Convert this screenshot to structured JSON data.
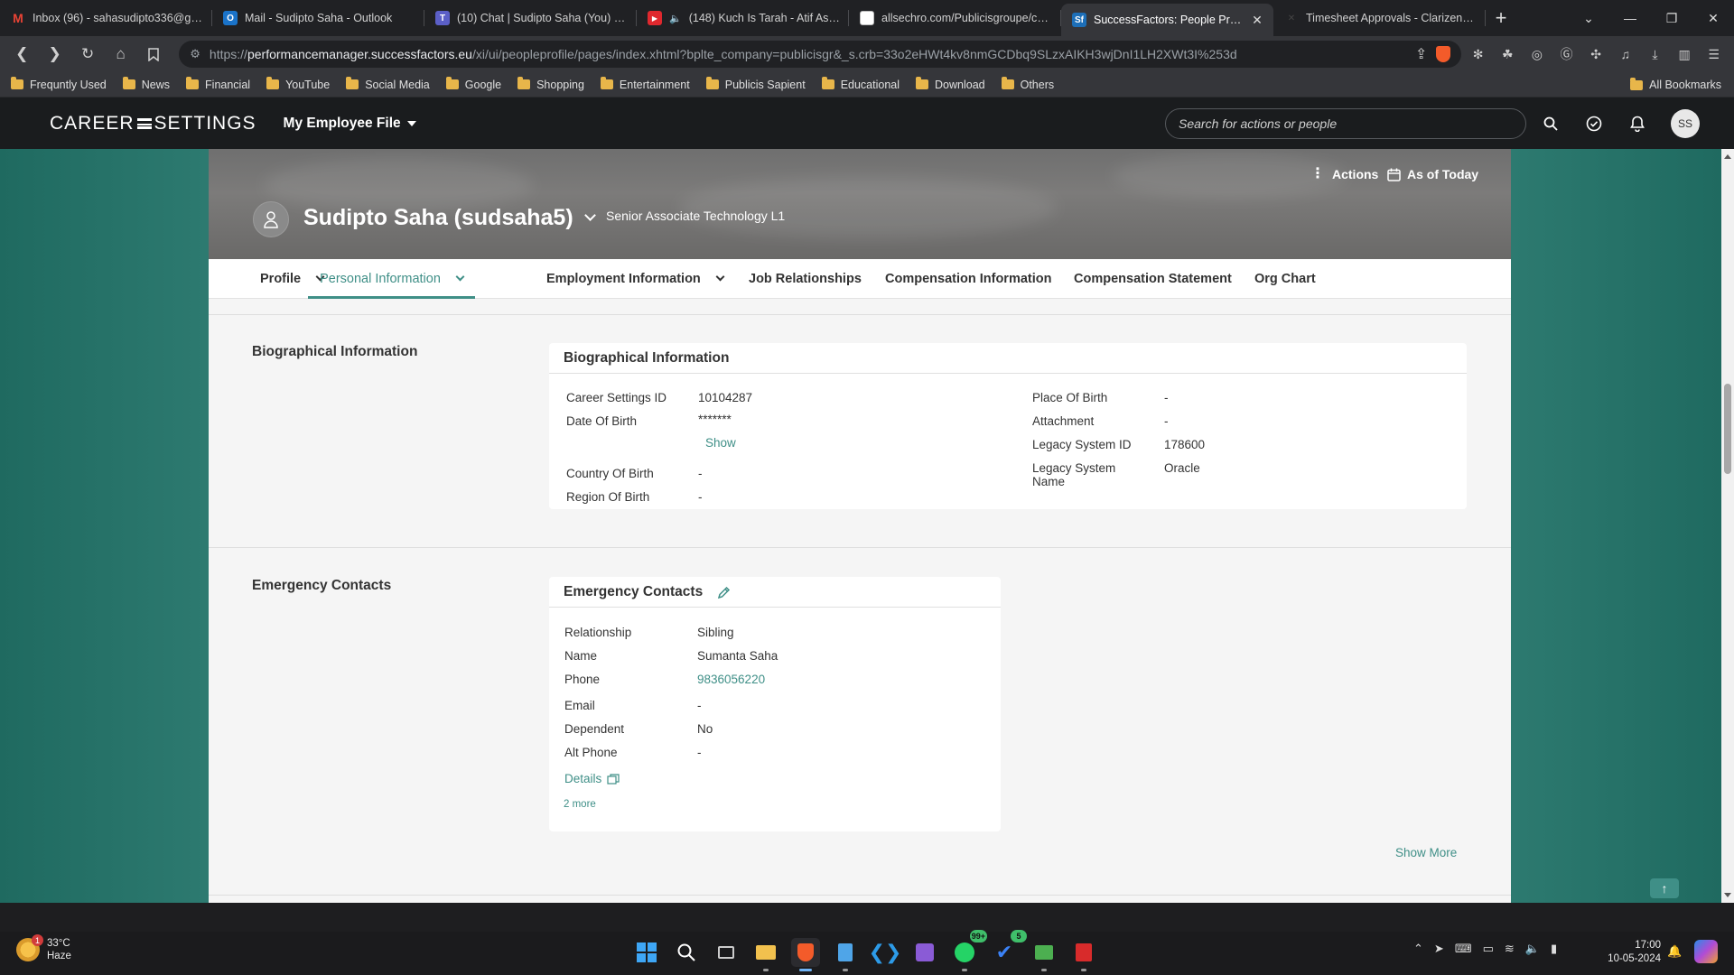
{
  "browser": {
    "tabs": [
      {
        "title": "Inbox (96) - sahasudipto336@gmail",
        "icon": "gmail-icon",
        "color": "#d44638",
        "glyph": "M"
      },
      {
        "title": "Mail - Sudipto Saha - Outlook",
        "icon": "outlook-icon",
        "color": "#1a73c9",
        "glyph": "O"
      },
      {
        "title": "(10) Chat | Sudipto Saha (You) | Micr",
        "icon": "teams-icon",
        "color": "#5b5fc7",
        "glyph": "T"
      },
      {
        "title": "(148) Kuch Is Tarah - Atif Aslam |",
        "icon": "youtube-icon",
        "color": "#e0282e",
        "glyph": "▶",
        "audio": "🔈"
      },
      {
        "title": "allsechro.com/Publicisgroupe/comm",
        "icon": "page-icon",
        "color": "#ffffff",
        "glyph": ""
      },
      {
        "title": "SuccessFactors: People Profile",
        "icon": "successfactors-icon",
        "color": "#1d6fb8",
        "glyph": "Sf",
        "active": true
      },
      {
        "title": "Timesheet Approvals - Clarizen.com",
        "icon": "clarizen-icon",
        "color": "#202124",
        "glyph": "✕"
      }
    ],
    "new_tab": "+",
    "url_host": "performancemanager.successfactors.eu",
    "url_prefix": "https://",
    "url_path": "/xi/ui/peopleprofile/pages/index.xhtml?bplte_company=publicisgr&_s.crb=33o2eHWt4kv8nmGCDbq9SLzxAIKH3wjDnI1LH2XWt3I%253d",
    "bookmarks": [
      "Frequntly Used",
      "News",
      "Financial",
      "YouTube",
      "Social Media",
      "Google",
      "Shopping",
      "Entertainment",
      "Publicis Sapient",
      "Educational",
      "Download",
      "Others"
    ],
    "all_bookmarks": "All Bookmarks"
  },
  "app": {
    "logo": "CAREER SETTINGS",
    "logo_left": "CAREER",
    "logo_right": "SETTINGS",
    "menu_label": "My Employee File",
    "search_placeholder": "Search for actions or people",
    "avatar_initials": "SS"
  },
  "profile": {
    "name": "Sudipto Saha (sudsaha5)",
    "job_title": "Senior Associate Technology L1",
    "actions_label": "Actions",
    "as_of_label": "As of Today",
    "tabs": [
      "Profile",
      "Personal Information",
      "Employment Information",
      "Job Relationships",
      "Compensation Information",
      "Compensation Statement",
      "Org Chart"
    ],
    "active_tab": "Personal Information"
  },
  "biographical": {
    "section_label": "Biographical Information",
    "card_title": "Biographical Information",
    "left": [
      {
        "label": "Career Settings ID",
        "value": "10104287"
      },
      {
        "label": "Date Of Birth",
        "value": "*******"
      },
      {
        "label": "Country Of Birth",
        "value": "-"
      },
      {
        "label": "Region Of Birth",
        "value": "-"
      }
    ],
    "show_label": "Show",
    "right": [
      {
        "label": "Place Of Birth",
        "value": "-"
      },
      {
        "label": "Attachment",
        "value": "-"
      },
      {
        "label": "Legacy System ID",
        "value": "178600"
      },
      {
        "label": "Legacy System Name",
        "value": "Oracle"
      }
    ]
  },
  "emergency": {
    "section_label": "Emergency Contacts",
    "card_title": "Emergency Contacts",
    "fields": [
      {
        "label": "Relationship",
        "value": "Sibling"
      },
      {
        "label": "Name",
        "value": "Sumanta Saha"
      },
      {
        "label": "Phone",
        "value": "9836056220"
      },
      {
        "label": "Email",
        "value": "-"
      },
      {
        "label": "Dependent",
        "value": "No"
      },
      {
        "label": "Alt Phone",
        "value": "-"
      }
    ],
    "details_label": "Details",
    "more_label": "2 more",
    "show_more_label": "Show More"
  },
  "taskbar": {
    "temperature": "33°C",
    "condition": "Haze",
    "weather_badge": "1",
    "whatsapp_count": "99+",
    "todo_count": "5",
    "time": "17:00",
    "date": "10-05-2024"
  }
}
